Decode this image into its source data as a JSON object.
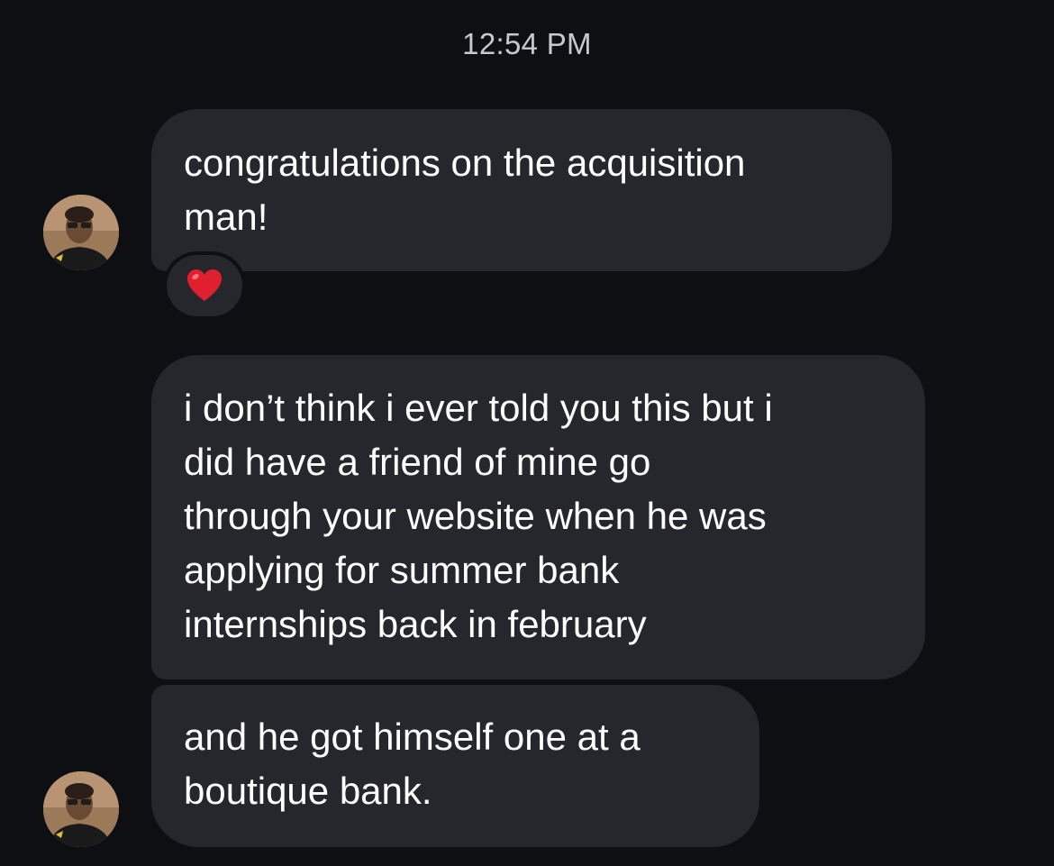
{
  "thread": {
    "timestamp": "12:54 PM",
    "messages": [
      {
        "text": "congratulations on the acquisition\nman!",
        "reaction": "heart-emoji"
      },
      {
        "text": "i don’t think i ever told you this but i\ndid have a friend of mine go\nthrough your website when he was\napplying for summer bank\ninternships back in february"
      },
      {
        "text": "and he got himself one at a\nboutique bank."
      }
    ]
  },
  "colors": {
    "background": "#0e0f13",
    "bubble": "#26272c",
    "timestamp": "#c8c9cf",
    "heart": "#e0202f"
  }
}
